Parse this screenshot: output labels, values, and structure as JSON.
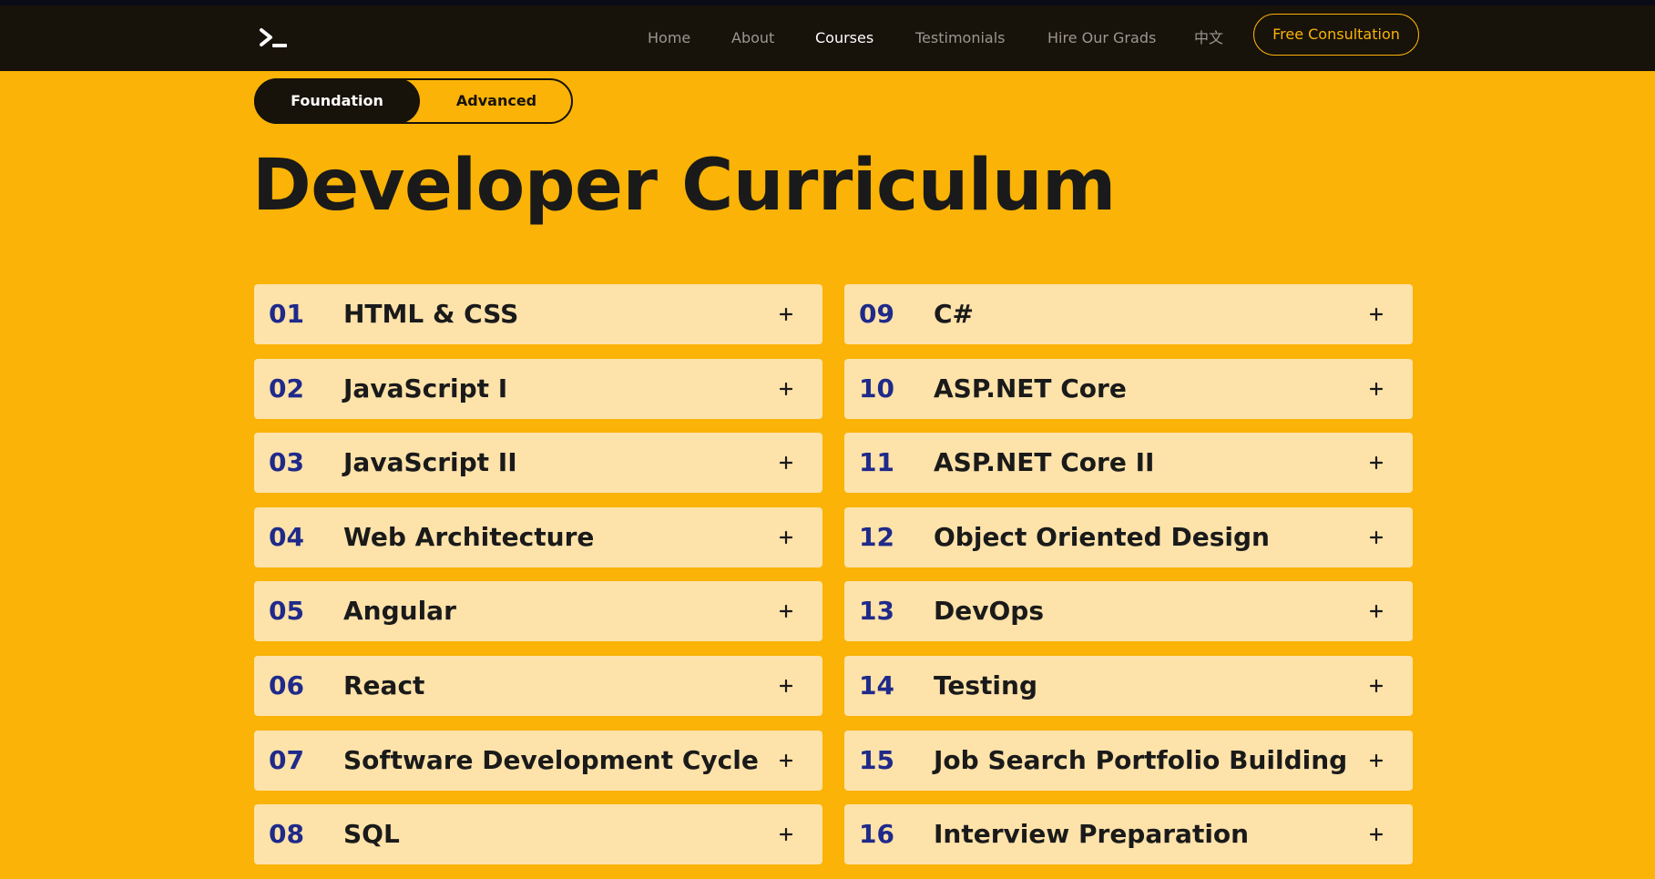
{
  "nav": {
    "logo_icon": "terminal-prompt-icon",
    "links": [
      "Home",
      "About",
      "Courses",
      "Testimonials",
      "Hire Our Grads",
      "中文"
    ],
    "active_link": "Courses",
    "cta_label": "Free Consultation"
  },
  "toggle": {
    "options": [
      "Foundation",
      "Advanced"
    ],
    "active": "Foundation"
  },
  "page": {
    "title": "Developer Curriculum"
  },
  "courses": [
    {
      "num": "01",
      "name": "HTML & CSS"
    },
    {
      "num": "02",
      "name": "JavaScript I"
    },
    {
      "num": "03",
      "name": "JavaScript II"
    },
    {
      "num": "04",
      "name": "Web Architecture"
    },
    {
      "num": "05",
      "name": "Angular"
    },
    {
      "num": "06",
      "name": "React"
    },
    {
      "num": "07",
      "name": "Software Development Cycle"
    },
    {
      "num": "08",
      "name": "SQL"
    },
    {
      "num": "09",
      "name": "C#"
    },
    {
      "num": "10",
      "name": "ASP.NET Core"
    },
    {
      "num": "11",
      "name": "ASP.NET Core II"
    },
    {
      "num": "12",
      "name": "Object Oriented Design"
    },
    {
      "num": "13",
      "name": "DevOps"
    },
    {
      "num": "14",
      "name": "Testing"
    },
    {
      "num": "15",
      "name": "Job Search Portfolio Building"
    },
    {
      "num": "16",
      "name": "Interview Preparation"
    }
  ],
  "expand_icon": "plus-icon",
  "colors": {
    "background": "#FAB306",
    "navbar": "#17120A",
    "card": "#FDE2AA",
    "number": "#1F2A8A",
    "text": "#1a1a1a"
  }
}
